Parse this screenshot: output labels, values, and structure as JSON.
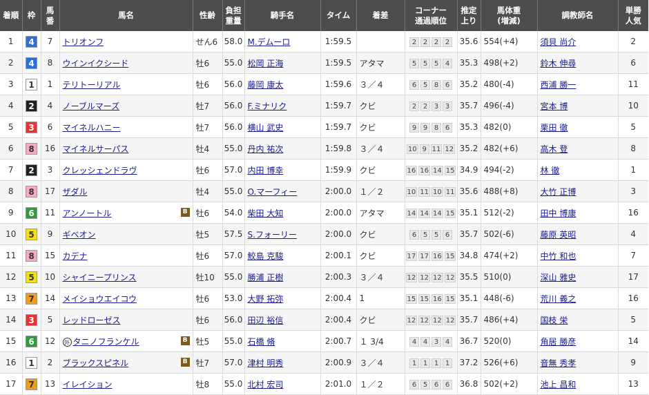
{
  "headers": [
    "着順",
    "枠",
    "馬番",
    "馬名",
    "性齢",
    "負担重量",
    "騎手名",
    "タイム",
    "着差",
    "コーナー通過順位",
    "推定上り",
    "馬体重(増減)",
    "調教師名",
    "単勝人気"
  ],
  "header_lines": [
    [
      "着順"
    ],
    [
      "枠"
    ],
    [
      "馬",
      "番"
    ],
    [
      "馬名"
    ],
    [
      "性齢"
    ],
    [
      "負担",
      "重量"
    ],
    [
      "騎手名"
    ],
    [
      "タイム"
    ],
    [
      "着差"
    ],
    [
      "コーナー",
      "通過順位"
    ],
    [
      "推定",
      "上り"
    ],
    [
      "馬体重",
      "(増減)"
    ],
    [
      "調教師名"
    ],
    [
      "単勝",
      "人気"
    ]
  ],
  "waku_colors": {
    "1": {
      "bg": "#ffffff",
      "fg": "#333333"
    },
    "2": {
      "bg": "#222222",
      "fg": "#ffffff"
    },
    "3": {
      "bg": "#e63333",
      "fg": "#ffffff"
    },
    "4": {
      "bg": "#2e6fd6",
      "fg": "#ffffff"
    },
    "5": {
      "bg": "#f2e01a",
      "fg": "#333333"
    },
    "6": {
      "bg": "#2f9b3a",
      "fg": "#ffffff"
    },
    "7": {
      "bg": "#f29a1a",
      "fg": "#333333"
    },
    "8": {
      "bg": "#f6a9c4",
      "fg": "#333333"
    }
  },
  "rows": [
    {
      "rank": "1",
      "waku": "4",
      "num": "7",
      "horse": "トリオンフ",
      "blinker": false,
      "maru": false,
      "sexage": "せん6",
      "weight": "58.0",
      "jockey": "M.デムーロ",
      "time": "1:59.5",
      "margin": "",
      "corners": [
        "2",
        "2",
        "2",
        "2"
      ],
      "last3f": "35.6",
      "body": "554",
      "diff": "(+4)",
      "trainer": "須貝 尚介",
      "pop": "2"
    },
    {
      "rank": "2",
      "waku": "4",
      "num": "8",
      "horse": "ウインイクシード",
      "blinker": false,
      "maru": false,
      "sexage": "牡6",
      "weight": "55.0",
      "jockey": "松岡 正海",
      "time": "1:59.5",
      "margin": "アタマ",
      "corners": [
        "5",
        "5",
        "5",
        "4"
      ],
      "last3f": "35.3",
      "body": "498",
      "diff": "(+2)",
      "trainer": "鈴木 伸尋",
      "pop": "6"
    },
    {
      "rank": "3",
      "waku": "1",
      "num": "1",
      "horse": "テリトーリアル",
      "blinker": false,
      "maru": false,
      "sexage": "牡6",
      "weight": "56.0",
      "jockey": "藤岡 康太",
      "time": "1:59.6",
      "margin": "３／４",
      "corners": [
        "6",
        "5",
        "8",
        "6"
      ],
      "last3f": "35.2",
      "body": "480",
      "diff": "(-4)",
      "trainer": "西浦 勝一",
      "pop": "11"
    },
    {
      "rank": "4",
      "waku": "2",
      "num": "4",
      "horse": "ノーブルマーズ",
      "blinker": false,
      "maru": false,
      "sexage": "牡7",
      "weight": "56.0",
      "jockey": "F.ミナリク",
      "time": "1:59.7",
      "margin": "クビ",
      "corners": [
        "2",
        "2",
        "3",
        "3"
      ],
      "last3f": "35.7",
      "body": "496",
      "diff": "(-4)",
      "trainer": "宮本 博",
      "pop": "10"
    },
    {
      "rank": "5",
      "waku": "3",
      "num": "6",
      "horse": "マイネルハニー",
      "blinker": false,
      "maru": false,
      "sexage": "牡7",
      "weight": "56.0",
      "jockey": "横山 武史",
      "time": "1:59.7",
      "margin": "クビ",
      "corners": [
        "9",
        "9",
        "8",
        "6"
      ],
      "last3f": "35.3",
      "body": "482",
      "diff": "(0)",
      "trainer": "栗田 徹",
      "pop": "5"
    },
    {
      "rank": "6",
      "waku": "8",
      "num": "16",
      "horse": "マイネルサーパス",
      "blinker": false,
      "maru": false,
      "sexage": "牡4",
      "weight": "55.0",
      "jockey": "丹内 祐次",
      "time": "1:59.8",
      "margin": "３／４",
      "corners": [
        "10",
        "9",
        "11",
        "12"
      ],
      "last3f": "35.2",
      "body": "482",
      "diff": "(+6)",
      "trainer": "高木 登",
      "pop": "8"
    },
    {
      "rank": "7",
      "waku": "2",
      "num": "3",
      "horse": "クレッシェンドラヴ",
      "blinker": false,
      "maru": false,
      "sexage": "牡6",
      "weight": "57.0",
      "jockey": "内田 博幸",
      "time": "1:59.9",
      "margin": "クビ",
      "corners": [
        "16",
        "16",
        "14",
        "15"
      ],
      "last3f": "34.9",
      "body": "494",
      "diff": "(-2)",
      "trainer": "林 徹",
      "pop": "1"
    },
    {
      "rank": "8",
      "waku": "8",
      "num": "17",
      "horse": "ザダル",
      "blinker": false,
      "maru": false,
      "sexage": "牡4",
      "weight": "55.0",
      "jockey": "O.マーフィー",
      "time": "2:00.0",
      "margin": "１／２",
      "corners": [
        "10",
        "11",
        "10",
        "11"
      ],
      "last3f": "35.6",
      "body": "488",
      "diff": "(+8)",
      "trainer": "大竹 正博",
      "pop": "3"
    },
    {
      "rank": "9",
      "waku": "6",
      "num": "11",
      "horse": "アンノートル",
      "blinker": true,
      "maru": false,
      "sexage": "牡6",
      "weight": "54.0",
      "jockey": "柴田 大知",
      "time": "2:00.0",
      "margin": "アタマ",
      "corners": [
        "14",
        "14",
        "14",
        "15"
      ],
      "last3f": "35.1",
      "body": "512",
      "diff": "(-2)",
      "trainer": "田中 博康",
      "pop": "16"
    },
    {
      "rank": "10",
      "waku": "5",
      "num": "9",
      "horse": "ギベオン",
      "blinker": false,
      "maru": false,
      "sexage": "牡5",
      "weight": "57.5",
      "jockey": "S.フォーリー",
      "time": "2:00.0",
      "margin": "クビ",
      "corners": [
        "6",
        "5",
        "5",
        "6"
      ],
      "last3f": "35.7",
      "body": "502",
      "diff": "(-6)",
      "trainer": "藤原 英昭",
      "pop": "4"
    },
    {
      "rank": "11",
      "waku": "8",
      "num": "15",
      "horse": "カデナ",
      "blinker": false,
      "maru": false,
      "sexage": "牡6",
      "weight": "57.0",
      "jockey": "鮫島 克駿",
      "time": "2:00.1",
      "margin": "クビ",
      "corners": [
        "17",
        "17",
        "16",
        "15"
      ],
      "last3f": "34.8",
      "body": "474",
      "diff": "(+2)",
      "trainer": "中竹 和也",
      "pop": "7"
    },
    {
      "rank": "12",
      "waku": "5",
      "num": "10",
      "horse": "シャイニープリンス",
      "blinker": false,
      "maru": false,
      "sexage": "牡10",
      "weight": "55.0",
      "jockey": "勝浦 正樹",
      "time": "2:00.3",
      "margin": "３／４",
      "corners": [
        "12",
        "12",
        "12",
        "12"
      ],
      "last3f": "35.5",
      "body": "510",
      "diff": "(0)",
      "trainer": "深山 雅史",
      "pop": "17"
    },
    {
      "rank": "13",
      "waku": "7",
      "num": "14",
      "horse": "メイショウエイコウ",
      "blinker": false,
      "maru": false,
      "sexage": "牡6",
      "weight": "53.0",
      "jockey": "大野 拓弥",
      "time": "2:00.4",
      "margin": "1",
      "corners": [
        "15",
        "15",
        "16",
        "15"
      ],
      "last3f": "35.1",
      "body": "448",
      "diff": "(-6)",
      "trainer": "荒川 義之",
      "pop": "16"
    },
    {
      "rank": "14",
      "waku": "3",
      "num": "5",
      "horse": "レッドローゼス",
      "blinker": false,
      "maru": false,
      "sexage": "牡6",
      "weight": "56.0",
      "jockey": "田辺 裕信",
      "time": "2:00.4",
      "margin": "クビ",
      "corners": [
        "12",
        "12",
        "12",
        "12"
      ],
      "last3f": "35.7",
      "body": "486",
      "diff": "(+4)",
      "trainer": "国枝 栄",
      "pop": "5"
    },
    {
      "rank": "15",
      "waku": "6",
      "num": "12",
      "horse": "タニノフランケル",
      "blinker": true,
      "maru": true,
      "maru_label": "外",
      "sexage": "牡5",
      "weight": "55.0",
      "jockey": "石橋 脩",
      "time": "2:00.7",
      "margin": "１ 3/4",
      "corners": [
        "4",
        "4",
        "3",
        "4"
      ],
      "last3f": "36.7",
      "body": "520",
      "diff": "(0)",
      "trainer": "角居 勝彦",
      "pop": "14"
    },
    {
      "rank": "16",
      "waku": "1",
      "num": "2",
      "horse": "ブラックスピネル",
      "blinker": true,
      "maru": false,
      "sexage": "牡7",
      "weight": "57.0",
      "jockey": "津村 明秀",
      "time": "2:00.9",
      "margin": "３／４",
      "corners": [
        "1",
        "1",
        "1",
        "1"
      ],
      "last3f": "37.2",
      "body": "526",
      "diff": "(+6)",
      "trainer": "音無 秀孝",
      "pop": "9"
    },
    {
      "rank": "17",
      "waku": "7",
      "num": "13",
      "horse": "イレイション",
      "blinker": false,
      "maru": false,
      "sexage": "牡8",
      "weight": "55.0",
      "jockey": "北村 宏司",
      "time": "2:01.0",
      "margin": "１／２",
      "corners": [
        "6",
        "5",
        "6",
        "6"
      ],
      "last3f": "36.8",
      "body": "502",
      "diff": "(+2)",
      "trainer": "池上 昌和",
      "pop": "13"
    }
  ],
  "blinker_label": "B"
}
